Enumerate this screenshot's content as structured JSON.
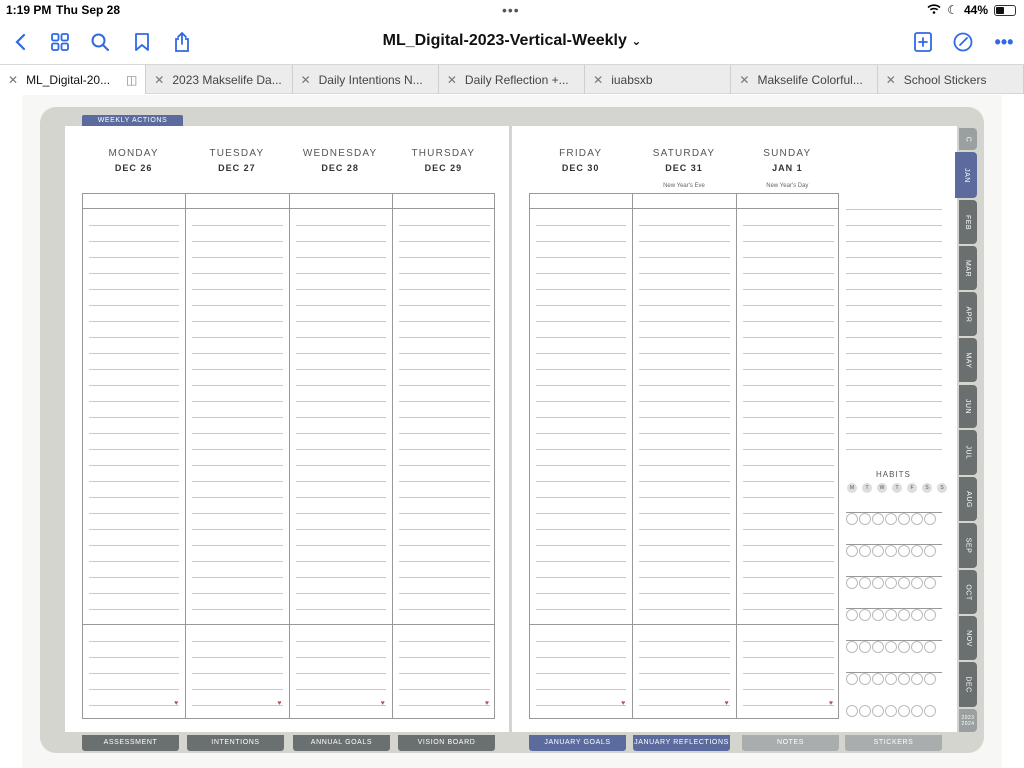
{
  "status": {
    "time": "1:19 PM",
    "date": "Thu Sep 28",
    "battery": "44%",
    "battery_level": 0.44
  },
  "toolbar": {
    "title": "ML_Digital-2023-Vertical-Weekly",
    "title_caret": "⌄"
  },
  "tabs": [
    {
      "label": "ML_Digital-20...",
      "active": true
    },
    {
      "label": "2023 Makselife Da..."
    },
    {
      "label": "Daily Intentions N..."
    },
    {
      "label": "Daily Reflection +..."
    },
    {
      "label": "iuabsxb"
    },
    {
      "label": "Makselife Colorful..."
    },
    {
      "label": "School Stickers"
    }
  ],
  "planner": {
    "weekly_actions_label": "WEEKLY ACTIONS",
    "days_left": [
      {
        "name": "MONDAY",
        "date": "DEC 26"
      },
      {
        "name": "TUESDAY",
        "date": "DEC 27"
      },
      {
        "name": "WEDNESDAY",
        "date": "DEC 28"
      },
      {
        "name": "THURSDAY",
        "date": "DEC 29"
      }
    ],
    "days_right": [
      {
        "name": "FRIDAY",
        "date": "DEC 30",
        "note": ""
      },
      {
        "name": "SATURDAY",
        "date": "DEC 31",
        "note": "New Year's Eve"
      },
      {
        "name": "SUNDAY",
        "date": "JAN 1",
        "note": "New Year's Day"
      }
    ],
    "habits_label": "HABITS",
    "habit_days": [
      "M",
      "T",
      "W",
      "T",
      "F",
      "S",
      "S"
    ],
    "month_tabs": [
      "C",
      "JAN",
      "FEB",
      "MAR",
      "APR",
      "MAY",
      "JUN",
      "JUL",
      "AUG",
      "SEP",
      "OCT",
      "NOV",
      "DEC",
      "2023 2024"
    ],
    "active_month": "JAN",
    "bottom_tabs": [
      {
        "label": "ASSESSMENT",
        "color": "#6a6f70"
      },
      {
        "label": "INTENTIONS",
        "color": "#6a6f70"
      },
      {
        "label": "ANNUAL GOALS",
        "color": "#6a6f70"
      },
      {
        "label": "VISION BOARD",
        "color": "#6a6f70"
      },
      {
        "label": "JANUARY GOALS",
        "color": "#5b6b9e"
      },
      {
        "label": "JANUARY REFLECTIONS",
        "color": "#5b6b9e"
      },
      {
        "label": "NOTES",
        "color": "#a9adad"
      },
      {
        "label": "STICKERS",
        "color": "#a9adad"
      }
    ]
  },
  "colors": {
    "accent": "#2f6ae6",
    "month_active": "#5b6b9e",
    "month_tab": "#6a6f70"
  }
}
